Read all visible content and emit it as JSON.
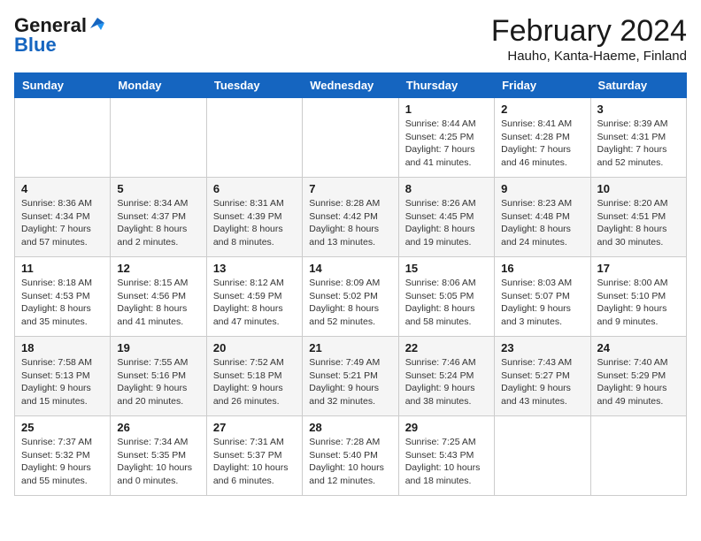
{
  "header": {
    "logo_general": "General",
    "logo_blue": "Blue",
    "title": "February 2024",
    "location": "Hauho, Kanta-Haeme, Finland"
  },
  "days_of_week": [
    "Sunday",
    "Monday",
    "Tuesday",
    "Wednesday",
    "Thursday",
    "Friday",
    "Saturday"
  ],
  "weeks": [
    [
      {
        "num": "",
        "detail": ""
      },
      {
        "num": "",
        "detail": ""
      },
      {
        "num": "",
        "detail": ""
      },
      {
        "num": "",
        "detail": ""
      },
      {
        "num": "1",
        "detail": "Sunrise: 8:44 AM\nSunset: 4:25 PM\nDaylight: 7 hours\nand 41 minutes."
      },
      {
        "num": "2",
        "detail": "Sunrise: 8:41 AM\nSunset: 4:28 PM\nDaylight: 7 hours\nand 46 minutes."
      },
      {
        "num": "3",
        "detail": "Sunrise: 8:39 AM\nSunset: 4:31 PM\nDaylight: 7 hours\nand 52 minutes."
      }
    ],
    [
      {
        "num": "4",
        "detail": "Sunrise: 8:36 AM\nSunset: 4:34 PM\nDaylight: 7 hours\nand 57 minutes."
      },
      {
        "num": "5",
        "detail": "Sunrise: 8:34 AM\nSunset: 4:37 PM\nDaylight: 8 hours\nand 2 minutes."
      },
      {
        "num": "6",
        "detail": "Sunrise: 8:31 AM\nSunset: 4:39 PM\nDaylight: 8 hours\nand 8 minutes."
      },
      {
        "num": "7",
        "detail": "Sunrise: 8:28 AM\nSunset: 4:42 PM\nDaylight: 8 hours\nand 13 minutes."
      },
      {
        "num": "8",
        "detail": "Sunrise: 8:26 AM\nSunset: 4:45 PM\nDaylight: 8 hours\nand 19 minutes."
      },
      {
        "num": "9",
        "detail": "Sunrise: 8:23 AM\nSunset: 4:48 PM\nDaylight: 8 hours\nand 24 minutes."
      },
      {
        "num": "10",
        "detail": "Sunrise: 8:20 AM\nSunset: 4:51 PM\nDaylight: 8 hours\nand 30 minutes."
      }
    ],
    [
      {
        "num": "11",
        "detail": "Sunrise: 8:18 AM\nSunset: 4:53 PM\nDaylight: 8 hours\nand 35 minutes."
      },
      {
        "num": "12",
        "detail": "Sunrise: 8:15 AM\nSunset: 4:56 PM\nDaylight: 8 hours\nand 41 minutes."
      },
      {
        "num": "13",
        "detail": "Sunrise: 8:12 AM\nSunset: 4:59 PM\nDaylight: 8 hours\nand 47 minutes."
      },
      {
        "num": "14",
        "detail": "Sunrise: 8:09 AM\nSunset: 5:02 PM\nDaylight: 8 hours\nand 52 minutes."
      },
      {
        "num": "15",
        "detail": "Sunrise: 8:06 AM\nSunset: 5:05 PM\nDaylight: 8 hours\nand 58 minutes."
      },
      {
        "num": "16",
        "detail": "Sunrise: 8:03 AM\nSunset: 5:07 PM\nDaylight: 9 hours\nand 3 minutes."
      },
      {
        "num": "17",
        "detail": "Sunrise: 8:00 AM\nSunset: 5:10 PM\nDaylight: 9 hours\nand 9 minutes."
      }
    ],
    [
      {
        "num": "18",
        "detail": "Sunrise: 7:58 AM\nSunset: 5:13 PM\nDaylight: 9 hours\nand 15 minutes."
      },
      {
        "num": "19",
        "detail": "Sunrise: 7:55 AM\nSunset: 5:16 PM\nDaylight: 9 hours\nand 20 minutes."
      },
      {
        "num": "20",
        "detail": "Sunrise: 7:52 AM\nSunset: 5:18 PM\nDaylight: 9 hours\nand 26 minutes."
      },
      {
        "num": "21",
        "detail": "Sunrise: 7:49 AM\nSunset: 5:21 PM\nDaylight: 9 hours\nand 32 minutes."
      },
      {
        "num": "22",
        "detail": "Sunrise: 7:46 AM\nSunset: 5:24 PM\nDaylight: 9 hours\nand 38 minutes."
      },
      {
        "num": "23",
        "detail": "Sunrise: 7:43 AM\nSunset: 5:27 PM\nDaylight: 9 hours\nand 43 minutes."
      },
      {
        "num": "24",
        "detail": "Sunrise: 7:40 AM\nSunset: 5:29 PM\nDaylight: 9 hours\nand 49 minutes."
      }
    ],
    [
      {
        "num": "25",
        "detail": "Sunrise: 7:37 AM\nSunset: 5:32 PM\nDaylight: 9 hours\nand 55 minutes."
      },
      {
        "num": "26",
        "detail": "Sunrise: 7:34 AM\nSunset: 5:35 PM\nDaylight: 10 hours\nand 0 minutes."
      },
      {
        "num": "27",
        "detail": "Sunrise: 7:31 AM\nSunset: 5:37 PM\nDaylight: 10 hours\nand 6 minutes."
      },
      {
        "num": "28",
        "detail": "Sunrise: 7:28 AM\nSunset: 5:40 PM\nDaylight: 10 hours\nand 12 minutes."
      },
      {
        "num": "29",
        "detail": "Sunrise: 7:25 AM\nSunset: 5:43 PM\nDaylight: 10 hours\nand 18 minutes."
      },
      {
        "num": "",
        "detail": ""
      },
      {
        "num": "",
        "detail": ""
      }
    ]
  ]
}
